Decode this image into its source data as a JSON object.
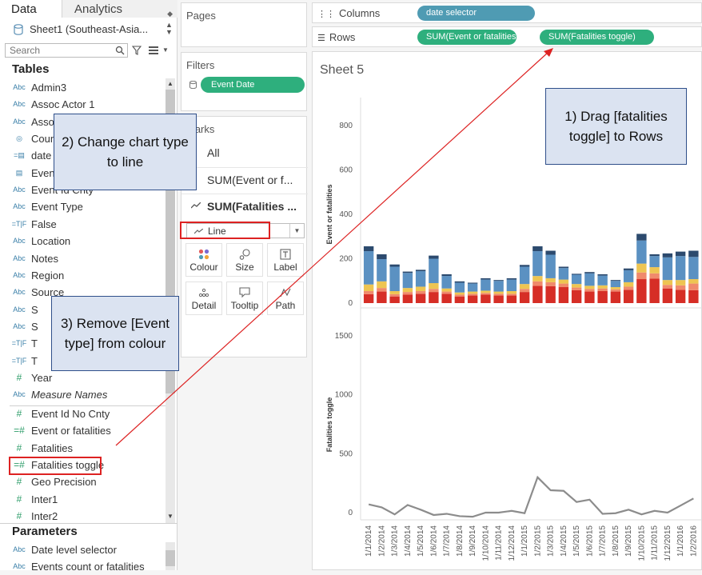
{
  "tabs": {
    "data": "Data",
    "analytics": "Analytics"
  },
  "datasource": "Sheet1 (Southeast-Asia...",
  "search": {
    "placeholder": "Search"
  },
  "tables_title": "Tables",
  "fields": [
    {
      "type": "Abc",
      "label": "Admin3"
    },
    {
      "type": "Abc",
      "label": "Assoc Actor 1"
    },
    {
      "type": "Abc",
      "label": "Assoc"
    },
    {
      "type": "globe",
      "label": "Coun"
    },
    {
      "type": "date",
      "label": "date"
    },
    {
      "type": "cal",
      "label": "Even"
    },
    {
      "type": "Abc",
      "label": "Event Id Cnty"
    },
    {
      "type": "Abc",
      "label": "Event Type"
    },
    {
      "type": "TF",
      "label": "False"
    },
    {
      "type": "Abc",
      "label": "Location"
    },
    {
      "type": "Abc",
      "label": "Notes"
    },
    {
      "type": "Abc",
      "label": "Region"
    },
    {
      "type": "Abc",
      "label": "Source"
    },
    {
      "type": "Abc",
      "label": "S"
    },
    {
      "type": "Abc",
      "label": "S"
    },
    {
      "type": "TF",
      "label": "T"
    },
    {
      "type": "TF",
      "label": "T"
    },
    {
      "type": "#",
      "label": "Year"
    },
    {
      "type": "Abc-meas",
      "label": "Measure Names"
    }
  ],
  "measures": [
    {
      "type": "#",
      "label": "Event Id No Cnty"
    },
    {
      "type": "=#",
      "label": "Event or fatalities"
    },
    {
      "type": "#",
      "label": "Fatalities"
    },
    {
      "type": "=#",
      "label": "Fatalities toggle"
    },
    {
      "type": "#",
      "label": "Geo Precision"
    },
    {
      "type": "#",
      "label": "Inter1"
    },
    {
      "type": "#",
      "label": "Inter2"
    }
  ],
  "parameters_title": "Parameters",
  "parameters": [
    {
      "type": "Abc",
      "label": "Date level selector"
    },
    {
      "type": "Abc",
      "label": "Events count or fatalities"
    }
  ],
  "pages_title": "Pages",
  "filters_title": "Filters",
  "filter_pill": "Event Date",
  "marks_title": "Marks",
  "marks_rows": {
    "all": "All",
    "field1": "SUM(Event or f...",
    "field2": "SUM(Fatalities ..."
  },
  "mark_type": "Line",
  "mark_buttons": {
    "colour": "Colour",
    "size": "Size",
    "label": "Label",
    "detail": "Detail",
    "tooltip": "Tooltip",
    "path": "Path"
  },
  "shelves": {
    "columns_label": "Columns",
    "rows_label": "Rows",
    "columns_pill": "date selector",
    "rows_pill1": "SUM(Event or fatalities)",
    "rows_pill2": "SUM(Fatalities toggle)"
  },
  "sheet_title": "Sheet 5",
  "annotations": {
    "note1": "1) Drag [fatalities toggle] to Rows",
    "note2": "2) Change chart type to line",
    "note3": "3) Remove [Event type] from colour"
  },
  "colors": {
    "accent_green": "#2eaf7d",
    "accent_blue": "#4f9bb3",
    "annotation_red": "#dd2222"
  },
  "chart_data": [
    {
      "type": "bar",
      "stacked": true,
      "ylabel": "Event or fatalities",
      "ylim": [
        0,
        850
      ],
      "yticks": [
        0,
        200,
        400,
        600,
        800
      ],
      "categories": [
        "1/1/2014",
        "1/2/2014",
        "1/3/2014",
        "1/4/2014",
        "1/5/2014",
        "1/6/2014",
        "1/7/2014",
        "1/8/2014",
        "1/9/2014",
        "1/10/2014",
        "1/11/2014",
        "1/12/2014",
        "1/1/2015",
        "1/2/2015",
        "1/3/2015",
        "1/4/2015",
        "1/5/2015",
        "1/6/2015",
        "1/7/2015",
        "1/8/2015",
        "1/9/2015",
        "1/10/2015",
        "1/11/2015",
        "1/12/2015",
        "1/1/2016",
        "1/2/2016"
      ],
      "series": [
        {
          "color": "#d62e26",
          "values": [
            40,
            52,
            30,
            38,
            42,
            50,
            42,
            30,
            34,
            38,
            34,
            34,
            50,
            78,
            76,
            72,
            58,
            52,
            54,
            52,
            60,
            108,
            110,
            66,
            60,
            58
          ]
        },
        {
          "color": "#f08a6c",
          "values": [
            14,
            16,
            10,
            12,
            12,
            14,
            10,
            8,
            8,
            8,
            8,
            8,
            14,
            20,
            18,
            16,
            12,
            12,
            12,
            10,
            14,
            30,
            24,
            16,
            20,
            30
          ]
        },
        {
          "color": "#eec552",
          "values": [
            30,
            30,
            14,
            18,
            20,
            26,
            14,
            10,
            10,
            10,
            10,
            12,
            22,
            24,
            18,
            18,
            16,
            14,
            14,
            10,
            20,
            40,
            28,
            22,
            24,
            20
          ]
        },
        {
          "color": "#5b91c2",
          "values": [
            150,
            100,
            110,
            68,
            70,
            110,
            56,
            44,
            36,
            50,
            48,
            52,
            78,
            112,
            106,
            52,
            42,
            56,
            44,
            28,
            54,
            104,
            50,
            102,
            108,
            100
          ]
        },
        {
          "color": "#2c4a6e",
          "values": [
            22,
            22,
            10,
            6,
            6,
            14,
            8,
            6,
            4,
            6,
            4,
            6,
            8,
            22,
            18,
            6,
            4,
            6,
            6,
            4,
            8,
            30,
            8,
            18,
            20,
            28
          ]
        }
      ]
    },
    {
      "type": "line",
      "ylabel": "Fatalities toggle",
      "ylim": [
        0,
        1700
      ],
      "yticks": [
        0,
        500,
        1000,
        1500
      ],
      "categories": [
        "1/1/2014",
        "1/2/2014",
        "1/3/2014",
        "1/4/2014",
        "1/5/2014",
        "1/6/2014",
        "1/7/2014",
        "1/8/2014",
        "1/9/2014",
        "1/10/2014",
        "1/11/2014",
        "1/12/2014",
        "1/1/2015",
        "1/2/2015",
        "1/3/2015",
        "1/4/2015",
        "1/5/2015",
        "1/6/2015",
        "1/7/2015",
        "1/8/2015",
        "1/9/2015",
        "1/10/2015",
        "1/11/2015",
        "1/12/2015",
        "1/1/2016",
        "1/2/2016"
      ],
      "series": [
        {
          "color": "#8c8c8c",
          "values": [
            70,
            45,
            -15,
            65,
            25,
            -20,
            -10,
            -30,
            -35,
            0,
            0,
            15,
            -5,
            300,
            190,
            185,
            90,
            110,
            -10,
            -5,
            25,
            -15,
            15,
            0,
            60,
            120
          ]
        }
      ]
    }
  ]
}
